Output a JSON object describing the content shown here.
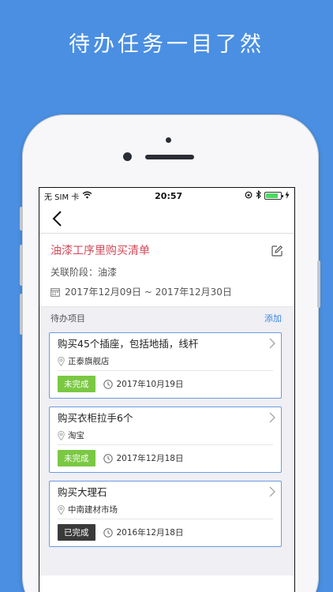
{
  "promo": {
    "title": "待办任务一目了然"
  },
  "status_bar": {
    "carrier": "无 SIM 卡",
    "time": "20:57"
  },
  "task": {
    "title": "油漆工序里购买清单",
    "stage": "关联阶段：油漆",
    "date_range": "2017年12月09日 ~ 2017年12月30日"
  },
  "list": {
    "header": "待办项目",
    "add_label": "添加",
    "items": [
      {
        "title": "购买45个插座，包括地插，线杆",
        "location": "正泰旗舰店",
        "status": "未完成",
        "date": "2017年10月19日"
      },
      {
        "title": "购买衣柜拉手6个",
        "location": "淘宝",
        "status": "未完成",
        "date": "2017年12月18日"
      },
      {
        "title": "购买大理石",
        "location": "中南建材市场",
        "status": "已完成",
        "date": "2016年12月18日"
      }
    ]
  },
  "colors": {
    "background": "#4a8fe2",
    "title_red": "#d24a5a",
    "undone_green": "#7ac843",
    "done_dark": "#3a3a3a",
    "link_blue": "#3b88e0"
  },
  "icons": [
    "back-chevron-icon",
    "edit-icon",
    "calendar-icon",
    "location-pin-icon",
    "clock-icon",
    "chevron-right-icon",
    "wifi-icon",
    "bluetooth-icon",
    "battery-icon"
  ]
}
